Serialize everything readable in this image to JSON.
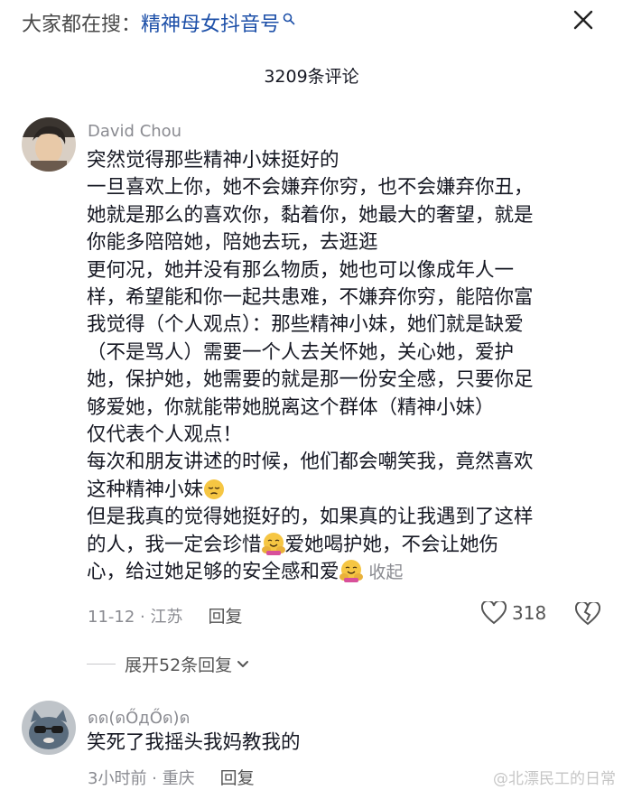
{
  "search": {
    "prefix": "大家都在搜：",
    "topic": "精神母女抖音号"
  },
  "comments_header": {
    "count_label": "3209条评论"
  },
  "comment1": {
    "author": "David Chou",
    "lines": [
      "突然觉得那些精神小妹挺好的",
      "一旦喜欢上你，她不会嫌弃你穷，也不会嫌弃你丑，",
      "她就是那么的喜欢你，黏着你，她最大的奢望，就是",
      "你能多陪陪她，陪她去玩，去逛逛",
      "更何况，她并没有那么物质，她也可以像成年人一",
      "样，希望能和你一起共患难，不嫌弃你穷，能陪你富",
      "我觉得（个人观点）：那些精神小妹，她们就是缺爱",
      "（不是骂人）需要一个人去关怀她，关心她，爱护",
      "她，保护她，她需要的就是那一份安全感，只要你足",
      "够爱她，你就能带她脱离这个群体（精神小妹）",
      "仅代表个人观点！",
      "每次和朋友讲述的时候，他们都会嘲笑我，竟然喜欢"
    ],
    "line13": "这种精神小妹",
    "line14": "但是我真的觉得她挺好的，如果真的让我遇到了这样",
    "line15a": "的人，我一定会珍惜",
    "line15b": "爱她喝护她，不会让她伤",
    "line16": "心，给过她足够的安全感和爱",
    "collapse": "收起",
    "date_location": "11-12 · 江苏",
    "reply": "回复",
    "likes": "318"
  },
  "expand_replies": "展开52条回复",
  "comment2": {
    "author": "ดด(ดŐдŐด)ด",
    "text": "笑死了我摇头我妈教我的",
    "date_location": "3小时前 · 重庆",
    "reply": "回复"
  },
  "watermark": "@北漂民工的日常",
  "colors": {
    "link": "#1c4fa8",
    "meta": "#8a8b91",
    "text": "#161823"
  },
  "icons": [
    "search-icon",
    "close-icon",
    "heart-icon",
    "broken-heart-icon",
    "chevron-down-icon",
    "pensive-emoji",
    "hug-emoji"
  ]
}
